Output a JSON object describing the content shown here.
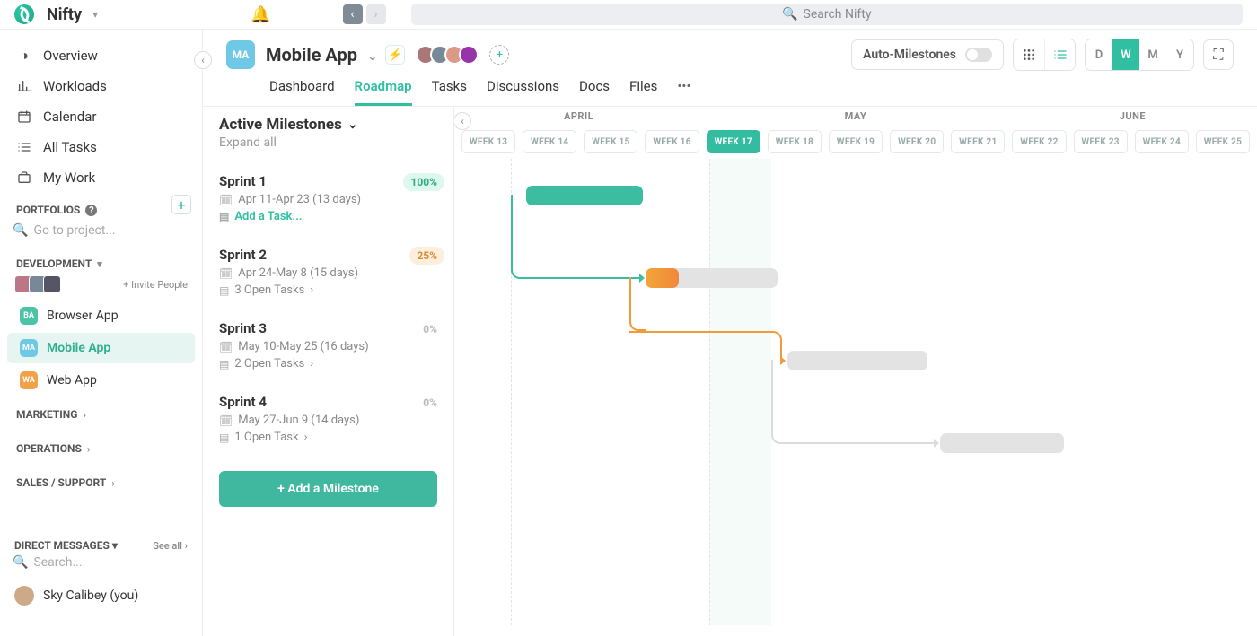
{
  "brand": "Nifty",
  "search": {
    "placeholder": "Search Nifty"
  },
  "sidebar": {
    "nav": [
      {
        "label": "Overview"
      },
      {
        "label": "Workloads"
      },
      {
        "label": "Calendar"
      },
      {
        "label": "All Tasks"
      },
      {
        "label": "My Work"
      }
    ],
    "portfolios_label": "PORTFOLIOS",
    "goto_placeholder": "Go to project...",
    "development_label": "DEVELOPMENT",
    "invite_label": "+ Invite People",
    "projects": [
      {
        "label": "Browser App",
        "badge": "BA",
        "color": "#4cc3a6"
      },
      {
        "label": "Mobile App",
        "badge": "MA",
        "color": "#6fc9e6",
        "active": true
      },
      {
        "label": "Web App",
        "badge": "WA",
        "color": "#f0a24a"
      }
    ],
    "marketing_label": "MARKETING",
    "operations_label": "OPERATIONS",
    "sales_label": "SALES / SUPPORT",
    "dm_label": "DIRECT MESSAGES",
    "see_all": "See all",
    "dm_search": "Search...",
    "dm_person": "Sky Calibey (you)"
  },
  "project": {
    "badge": "MA",
    "title": "Mobile App",
    "auto_ms": "Auto-Milestones",
    "zoom": [
      "D",
      "W",
      "M",
      "Y"
    ],
    "zoom_active": "W",
    "tabs": [
      "Dashboard",
      "Roadmap",
      "Tasks",
      "Discussions",
      "Docs",
      "Files"
    ],
    "active_tab": "Roadmap"
  },
  "roadmap": {
    "title": "Active Milestones",
    "expand": "Expand all",
    "add_ms": "+ Add a Milestone",
    "months": [
      "APRIL",
      "MAY",
      "JUNE"
    ],
    "weeks": [
      "WEEK 13",
      "WEEK 14",
      "WEEK 15",
      "WEEK 16",
      "WEEK 17",
      "WEEK 18",
      "WEEK 19",
      "WEEK 20",
      "WEEK 21",
      "WEEK 22",
      "WEEK 23",
      "WEEK 24",
      "WEEK 25"
    ],
    "active_week": "WEEK 17",
    "milestones": [
      {
        "name": "Sprint 1",
        "date": "Apr 11-Apr 23 (13 days)",
        "sub": "Add a Task...",
        "sub_link": true,
        "pct": "100%",
        "pct_class": "green"
      },
      {
        "name": "Sprint 2",
        "date": "Apr 24-May 8 (15 days)",
        "sub": "3 Open Tasks",
        "pct": "25%",
        "pct_class": "orange"
      },
      {
        "name": "Sprint 3",
        "date": "May 10-May 25 (16 days)",
        "sub": "2 Open Tasks",
        "pct": "0%",
        "pct_class": "gray"
      },
      {
        "name": "Sprint 4",
        "date": "May 27-Jun 9 (14 days)",
        "sub": "1 Open Task",
        "pct": "0%",
        "pct_class": "gray"
      }
    ]
  }
}
